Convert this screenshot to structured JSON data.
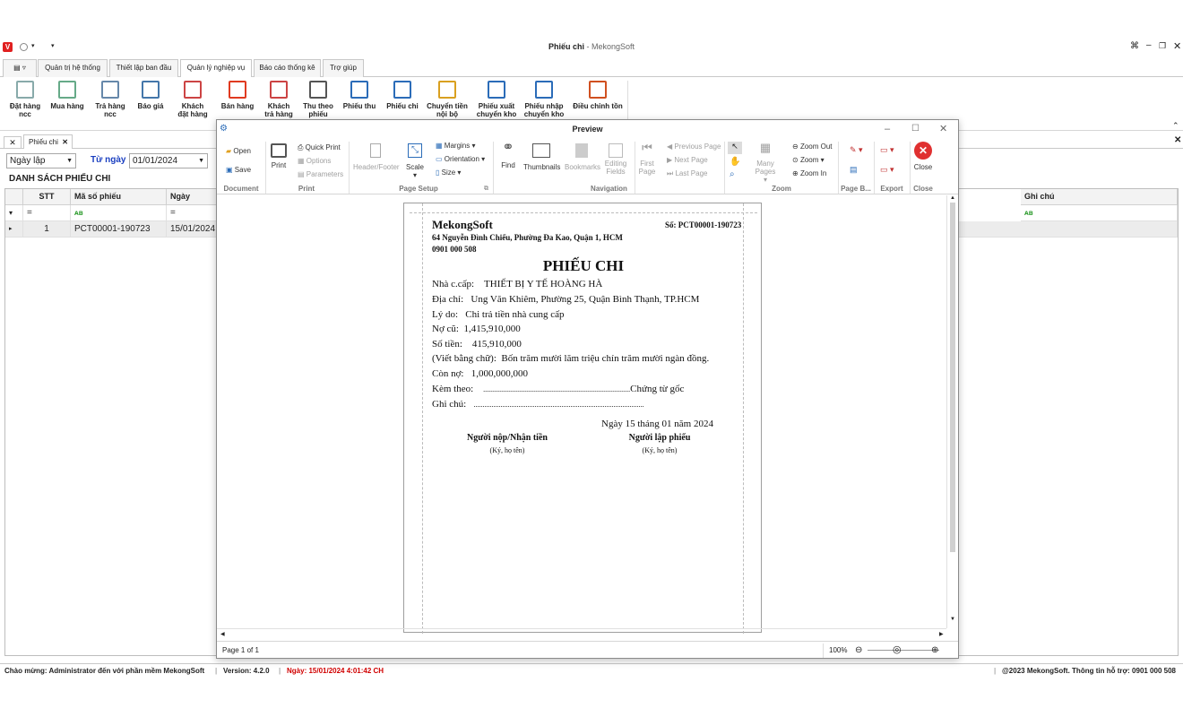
{
  "window": {
    "title_main": "Phiếu chi",
    "title_sep": " - ",
    "title_app": "MekongSoft"
  },
  "tabs": [
    "Quản trị hệ thống",
    "Thiết lập ban đầu",
    "Quản lý nghiệp vụ",
    "Báo cáo thống kê",
    "Trợ giúp"
  ],
  "ribbon": [
    {
      "l1": "Đặt hàng",
      "l2": "ncc",
      "icon": "order-supplier-icon"
    },
    {
      "l1": "Mua hàng",
      "l2": "",
      "icon": "purchase-icon"
    },
    {
      "l1": "Trả hàng",
      "l2": "ncc",
      "icon": "return-supplier-icon"
    },
    {
      "l1": "Báo giá",
      "l2": "",
      "icon": "quotation-icon"
    },
    {
      "l1": "Khách",
      "l2": "đặt hàng",
      "icon": "customer-order-icon"
    },
    {
      "l1": "Bán hàng",
      "l2": "",
      "icon": "cart-icon"
    },
    {
      "l1": "Khách",
      "l2": "trả hàng",
      "icon": "customer-return-icon"
    },
    {
      "l1": "Thu theo",
      "l2": "phiếu",
      "icon": "collect-icon"
    },
    {
      "l1": "Phiếu thu",
      "l2": "",
      "icon": "arrow-down-icon"
    },
    {
      "l1": "Phiếu chi",
      "l2": "",
      "icon": "arrow-up-icon"
    },
    {
      "l1": "Chuyển tiền",
      "l2": "nội bộ",
      "icon": "money-transfer-icon"
    },
    {
      "l1": "Phiếu xuất",
      "l2": "chuyển kho",
      "icon": "arrow-right-icon"
    },
    {
      "l1": "Phiếu nhập",
      "l2": "chuyển kho",
      "icon": "arrow-left-icon"
    },
    {
      "l1": "Điều chỉnh tồn",
      "l2": "",
      "icon": "adjust-stock-icon"
    }
  ],
  "doc_tab": "Phiếu chi",
  "filter": {
    "date_type": "Ngày lập",
    "from_label": "Từ ngày",
    "from_value": "01/01/2024"
  },
  "list_title": "DANH SÁCH PHIẾU CHI",
  "grid": {
    "headers": {
      "stt": "STT",
      "code": "Mã số phiếu",
      "date": "Ngày",
      "note": "Ghi chú"
    },
    "filter_ops": {
      "stt": "=",
      "date": "="
    },
    "rows": [
      {
        "stt": "1",
        "code": "PCT00001-190723",
        "date": "15/01/2024"
      }
    ]
  },
  "preview": {
    "title": "Preview",
    "buttons": {
      "open": "Open",
      "save": "Save",
      "print": "Print",
      "quick_print": "Quick Print",
      "options": "Options",
      "parameters": "Parameters",
      "header_footer": "Header/Footer",
      "scale": "Scale",
      "margins": "Margins",
      "orientation": "Orientation",
      "size": "Size",
      "find": "Find",
      "thumbnails": "Thumbnails",
      "bookmarks": "Bookmarks",
      "editing_fields_1": "Editing",
      "editing_fields_2": "Fields",
      "first_page_1": "First",
      "first_page_2": "Page",
      "previous_page": "Previous Page",
      "next_page": "Next Page",
      "last_page": "Last Page",
      "many_pages": "Many Pages",
      "zoom_out": "Zoom Out",
      "zoom": "Zoom",
      "zoom_in": "Zoom In",
      "close": "Close"
    },
    "groups": {
      "document": "Document",
      "print": "Print",
      "page_setup": "Page Setup",
      "navigation": "Navigation",
      "zoom": "Zoom",
      "page_bg": "Page B...",
      "export": "Export",
      "close": "Close"
    },
    "status": {
      "page": "Page 1 of 1",
      "zoom": "100%"
    }
  },
  "document": {
    "company": "MekongSoft",
    "number": "Số: PCT00001-190723",
    "address": "64 Nguyễn Đình Chiểu, Phường Đa Kao, Quận 1, HCM",
    "phone": "0901 000 508",
    "heading": "PHIẾU CHI",
    "supplier_label": "Nhà c.cấp:",
    "supplier": "THIẾT BỊ Y TẾ HOÀNG HÀ",
    "address_label": "Địa chỉ:",
    "supplier_address": "Ung Văn Khiêm, Phường 25, Quận Bình Thạnh, TP.HCM",
    "reason_label": "Lý do:",
    "reason": "Chi trả tiền nhà cung cấp",
    "old_debt_label": "Nợ cũ:",
    "old_debt": "1,415,910,000",
    "amount_label": "Số tiền:",
    "amount": "415,910,000",
    "in_words_label": "(Viết bằng chữ):",
    "in_words": "Bốn trăm mười lăm triệu chín trăm mười ngàn đồng.",
    "remaining_label": "Còn nợ:",
    "remaining": "1,000,000,000",
    "attached_label": "Kèm theo:",
    "attached_dots": "..................................................................................",
    "attached_suffix": "Chứng từ gốc",
    "note_label": "Ghi chú:",
    "note_dots": "...............................................................................................",
    "date_line": "Ngày 15 tháng 01 năm 2024",
    "sig1": "Người nộp/Nhận tiền",
    "sig1_sub": "(Ký, họ tên)",
    "sig2": "Người lập phiếu",
    "sig2_sub": "(Ký, họ tên)"
  },
  "statusbar": {
    "welcome": "Chào mừng: Administrator đến với phần mềm MekongSoft",
    "version": "Version: 4.2.0",
    "date": "Ngày: 15/01/2024 4:01:42 CH",
    "copyright": "@2023 MekongSoft. Thông tin hỗ trợ: 0901 000 508"
  },
  "colors": {
    "accent_blue": "#2b6cb8",
    "close_red": "#e03030",
    "status_red": "#d00000",
    "logo_red": "#e02020"
  }
}
